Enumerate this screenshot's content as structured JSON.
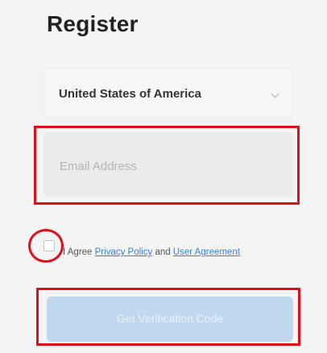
{
  "register": {
    "title": "Register",
    "country": {
      "selected": "United States of America",
      "chevron_icon": "chevron-down-icon"
    },
    "email": {
      "placeholder": "Email Address"
    },
    "agreement": {
      "prefix": "I Agree",
      "privacy_link": "Privacy Policy",
      "connector": "and",
      "user_link": "User Agreement",
      "checked": false
    },
    "submit_label": "Get Verification Code"
  },
  "annotations": {
    "highlight_color": "#e0101a"
  },
  "colors": {
    "link": "#3b7fcf",
    "button_disabled": "#c0d8ee"
  }
}
